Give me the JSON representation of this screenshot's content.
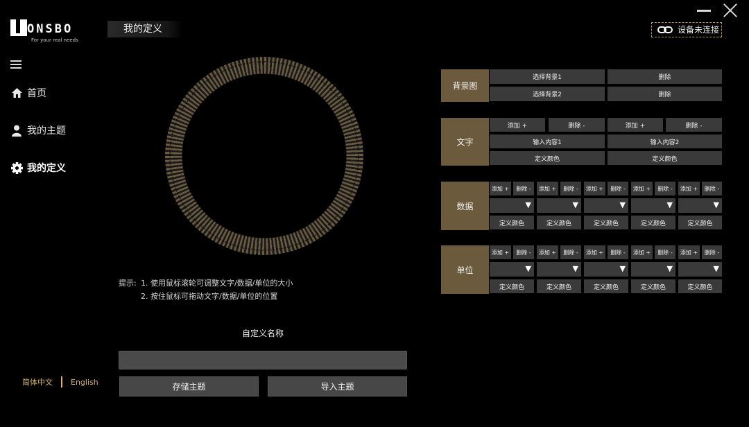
{
  "window": {
    "minimize": "—",
    "close": "✕"
  },
  "logo": {
    "word": "ONSBO",
    "tagline": "For your real needs"
  },
  "page_title": "我的定义",
  "device_status": {
    "label": "设备未连接",
    "icon": "link-icon"
  },
  "sidebar": {
    "menu_icon": "hamburger-icon",
    "items": [
      {
        "label": "首页",
        "icon": "home-icon"
      },
      {
        "label": "我的主题",
        "icon": "user-icon"
      },
      {
        "label": "我的定义",
        "icon": "gear-icon",
        "active": true
      }
    ]
  },
  "language": {
    "zh": "简体中文",
    "en": "English"
  },
  "tips": {
    "prefix": "提示:",
    "line1": "1. 使用鼠标滚轮可调整文字/数据/单位的大小",
    "line2": "2. 按住鼠标可拖动文字/数据/单位的位置"
  },
  "custom_name": {
    "label": "自定义名称",
    "value": "",
    "placeholder": ""
  },
  "buttons": {
    "save": "存储主题",
    "import": "导入主题"
  },
  "panel": {
    "background": {
      "label": "背景图",
      "select1": "选择背景1",
      "delete1": "删除",
      "select2": "选择背景2",
      "delete2": "删除"
    },
    "text": {
      "label": "文字",
      "add": "添加 +",
      "remove": "删除 -",
      "input1": "输入内容1",
      "input2": "输入内容2",
      "color": "定义颜色"
    },
    "data": {
      "label": "数据",
      "add": "添加 +",
      "remove": "删除 -",
      "color": "定义颜色",
      "arrow": "▼"
    },
    "unit": {
      "label": "单位",
      "add": "添加 +",
      "remove": "删除 -",
      "color": "定义颜色",
      "arrow": "▼"
    }
  }
}
